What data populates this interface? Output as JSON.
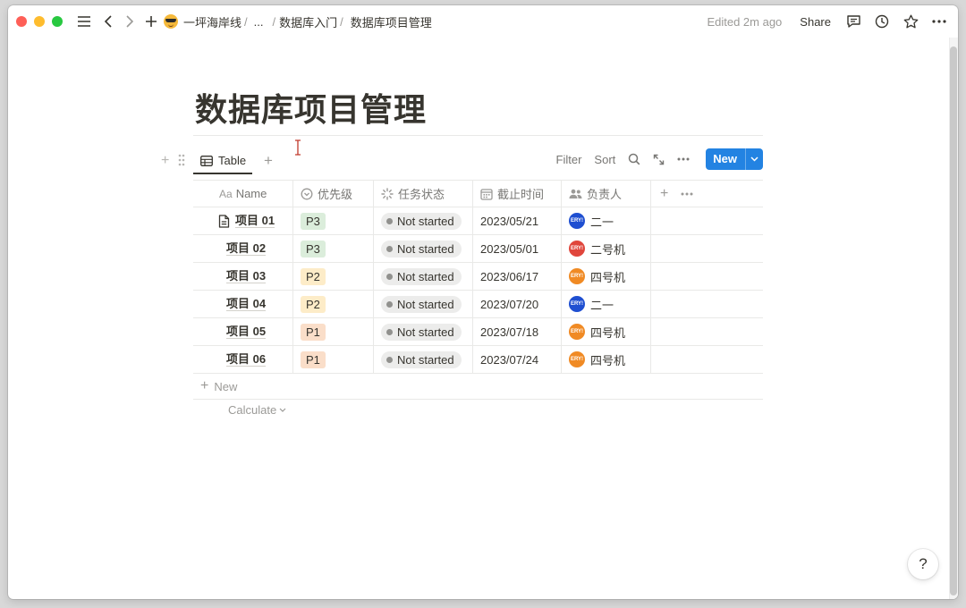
{
  "breadcrumb": {
    "items": [
      "一坪海岸线",
      "...",
      "数据库入门",
      "数据库项目管理"
    ],
    "separator": "/"
  },
  "topbar": {
    "edited": "Edited 2m ago",
    "share": "Share",
    "icons": [
      "menu-icon",
      "back-icon",
      "forward-icon",
      "add-icon",
      "comment-icon",
      "clock-icon",
      "star-icon",
      "more-icon"
    ]
  },
  "page": {
    "title": "数据库项目管理"
  },
  "view": {
    "tab_label": "Table",
    "filter": "Filter",
    "sort": "Sort",
    "new_button": "New"
  },
  "table": {
    "headers": {
      "name": "Name",
      "name_prefix": "Aa",
      "priority": "优先级",
      "status": "任务状态",
      "date": "截止时间",
      "owner": "负责人"
    },
    "rows": [
      {
        "name": "项目 01",
        "priority": "P3",
        "status": "Not started",
        "date": "2023/05/21",
        "owner": "二一",
        "avatar": "ERY!"
      },
      {
        "name": "项目 02",
        "priority": "P3",
        "status": "Not started",
        "date": "2023/05/01",
        "owner": "二号机",
        "avatar": "ERY!"
      },
      {
        "name": "项目 03",
        "priority": "P2",
        "status": "Not started",
        "date": "2023/06/17",
        "owner": "四号机",
        "avatar": "ERY!"
      },
      {
        "name": "项目 04",
        "priority": "P2",
        "status": "Not started",
        "date": "2023/07/20",
        "owner": "二一",
        "avatar": "ERY!"
      },
      {
        "name": "项目 05",
        "priority": "P1",
        "status": "Not started",
        "date": "2023/07/18",
        "owner": "四号机",
        "avatar": "ERY!"
      },
      {
        "name": "项目 06",
        "priority": "P1",
        "status": "Not started",
        "date": "2023/07/24",
        "owner": "四号机",
        "avatar": "ERY!"
      }
    ],
    "new_row": "New",
    "calculate": "Calculate"
  },
  "colors": {
    "p3": "#dbeddb",
    "p2": "#fdecc8",
    "p1": "#fadec9",
    "avatar_blue": "#1f4fd1",
    "avatar_red": "#e0463c",
    "avatar_orange": "#f08a24",
    "accent": "#2383e2"
  },
  "help": "?"
}
